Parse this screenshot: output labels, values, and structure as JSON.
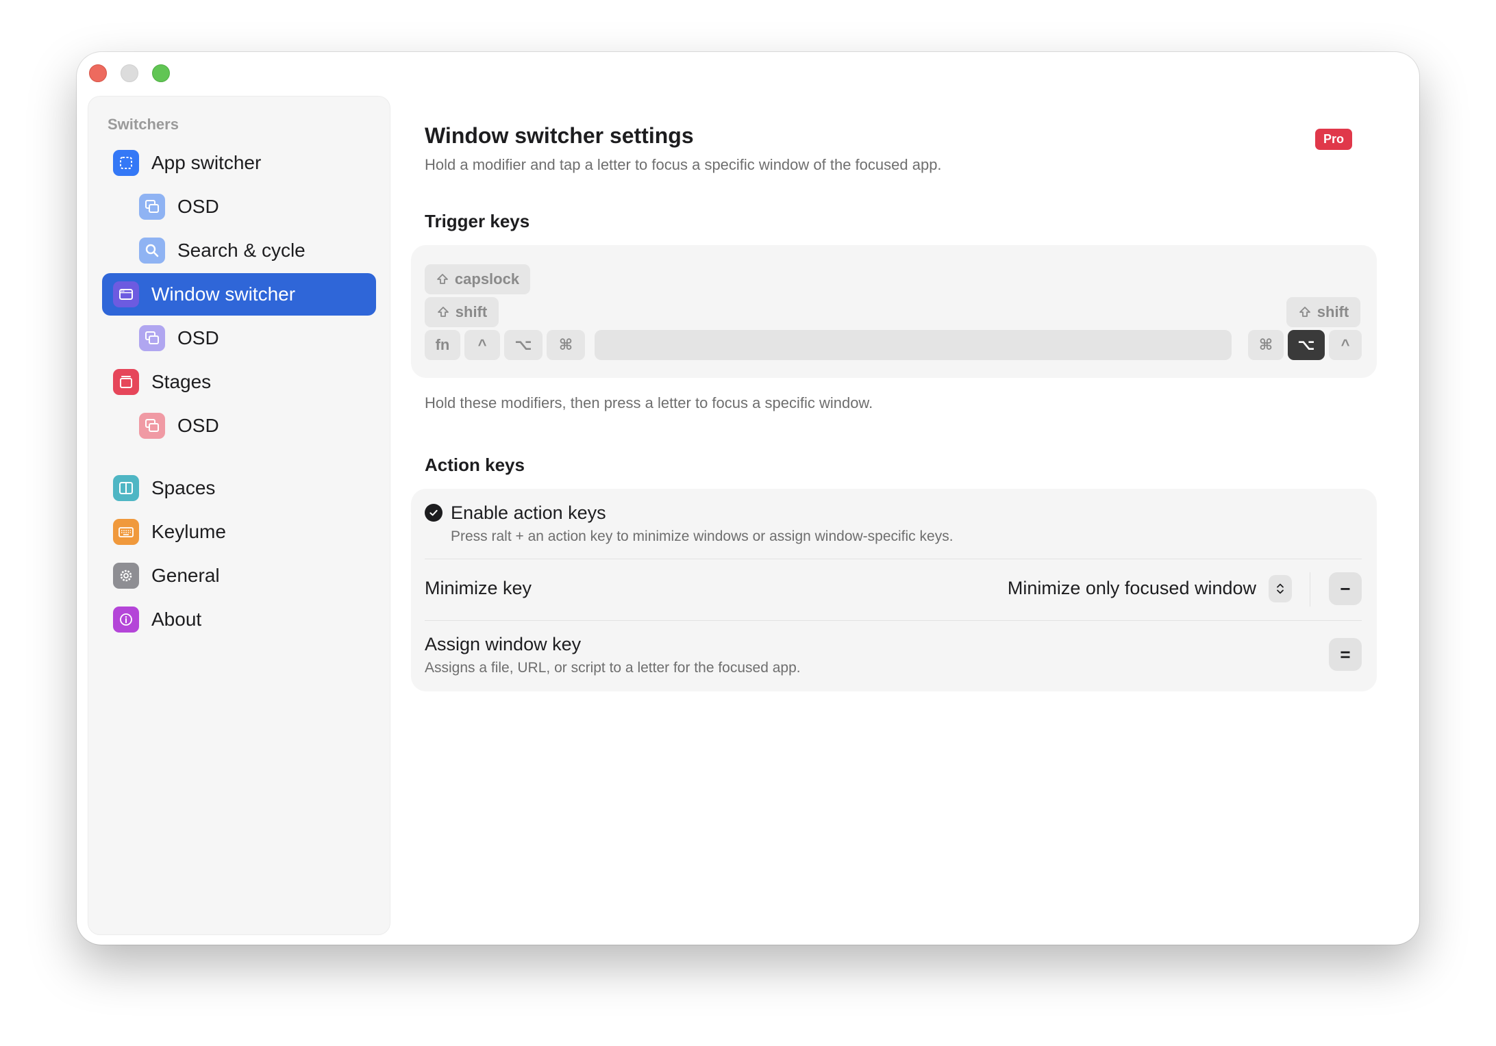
{
  "sidebar": {
    "section": "Switchers",
    "items": [
      {
        "label": "App switcher",
        "icon": "dashed-square-icon",
        "color": "#3478f6"
      },
      {
        "label": "OSD",
        "icon": "windows-stack-icon",
        "color": "#8fb3f3"
      },
      {
        "label": "Search & cycle",
        "icon": "magnifier-icon",
        "color": "#8fb3f3"
      },
      {
        "label": "Window switcher",
        "icon": "window-icon",
        "color": "#6d5be0"
      },
      {
        "label": "OSD",
        "icon": "windows-stack-icon",
        "color": "#b0a6f0"
      },
      {
        "label": "Stages",
        "icon": "stages-icon",
        "color": "#e6465a"
      },
      {
        "label": "OSD",
        "icon": "windows-stack-icon",
        "color": "#f09aa4"
      },
      {
        "label": "Spaces",
        "icon": "split-square-icon",
        "color": "#4fb6c4"
      },
      {
        "label": "Keylume",
        "icon": "keyboard-icon",
        "color": "#f0993c"
      },
      {
        "label": "General",
        "icon": "gear-icon",
        "color": "#8e8e93"
      },
      {
        "label": "About",
        "icon": "info-icon",
        "color": "#b445d8"
      }
    ],
    "active_color": "#2f66d8"
  },
  "header": {
    "title": "Window switcher settings",
    "subtitle": "Hold a modifier and tap a letter to focus a specific window of the focused app.",
    "badge": "Pro"
  },
  "trigger": {
    "heading": "Trigger keys",
    "capslock": "capslock",
    "shift_left": "shift",
    "shift_right": "shift",
    "fn": "fn",
    "ctrl_left": "^",
    "opt_left": "⌥",
    "cmd_left": "⌘",
    "cmd_right": "⌘",
    "opt_right": "⌥",
    "ctrl_right": "^",
    "hint": "Hold these modifiers, then press a letter to focus a specific window."
  },
  "action": {
    "heading": "Action keys",
    "enable_label": "Enable action keys",
    "enable_desc": "Press ralt + an action key to minimize windows or assign window-specific keys.",
    "minimize_label": "Minimize key",
    "minimize_value": "Minimize only focused window",
    "minimize_key": "−",
    "assign_label": "Assign window key",
    "assign_desc": "Assigns a file, URL, or script to a letter for the focused app.",
    "assign_key": "="
  }
}
